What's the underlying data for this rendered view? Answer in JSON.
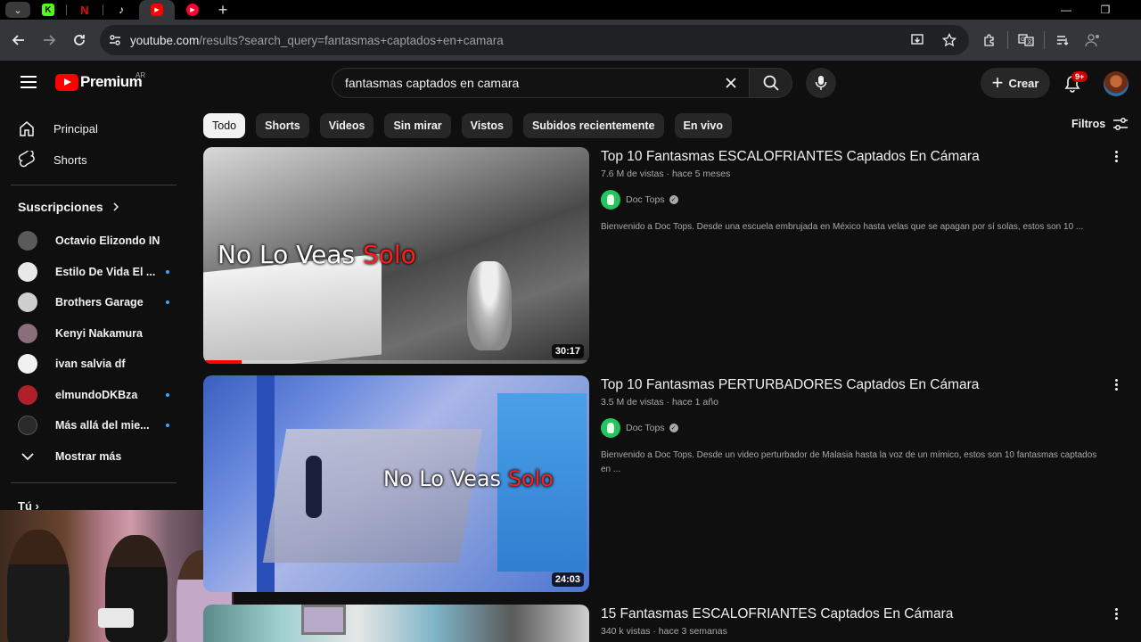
{
  "browser": {
    "url_host": "youtube.com",
    "url_rest": "/results?search_query=fantasmas+captados+en+camara"
  },
  "header": {
    "logo_text": "Premium",
    "country_code": "AR",
    "search_value": "fantasmas captados en camara",
    "create_label": "Crear",
    "notif_badge": "9+"
  },
  "sidebar": {
    "main": [
      {
        "label": "Principal",
        "icon": "home-icon"
      },
      {
        "label": "Shorts",
        "icon": "shorts-icon"
      }
    ],
    "subs_heading": "Suscripciones",
    "subs": [
      {
        "name": "Octavio Elizondo IN...",
        "color": "#5a5a5a",
        "dot": false
      },
      {
        "name": "Estilo De Vida El ...",
        "color": "#e8e8e8",
        "dot": true
      },
      {
        "name": "Brothers Garage",
        "color": "#cfcfcf",
        "dot": true
      },
      {
        "name": "Kenyi Nakamura",
        "color": "#8a6f7a",
        "dot": false
      },
      {
        "name": "ivan salvia df",
        "color": "#f1f1f1",
        "dot": false
      },
      {
        "name": "elmundoDKBza",
        "color": "#b0202a",
        "dot": true
      },
      {
        "name": "Más allá del mie...",
        "color": "#2a2a2a",
        "dot": true
      }
    ],
    "show_more": "Mostrar más",
    "you_heading": "Tú"
  },
  "chips": [
    "Todo",
    "Shorts",
    "Videos",
    "Sin mirar",
    "Vistos",
    "Subidos recientemente",
    "En vivo"
  ],
  "filters_label": "Filtros",
  "results": [
    {
      "title": "Top 10 Fantasmas ESCALOFRIANTES Captados En Cámara",
      "meta": "7.6 M de vistas · hace 5 meses",
      "channel": "Doc Tops",
      "description": "Bienvenido a Doc Tops. Desde una escuela embrujada en México hasta velas que se apagan por sí solas, estos son 10 ...",
      "duration": "30:17",
      "overlay_white": "No Lo Veas ",
      "overlay_red": "Solo",
      "watched_fraction": 0.1
    },
    {
      "title": "Top 10 Fantasmas PERTURBADORES Captados En Cámara",
      "meta": "3.5 M de vistas · hace 1 año",
      "channel": "Doc Tops",
      "description": "Bienvenido a Doc Tops. Desde un video perturbador de Malasia hasta la voz de un mímico, estos son 10 fantasmas captados en ...",
      "duration": "24:03",
      "overlay_white": "No Lo Veas ",
      "overlay_red": "Solo"
    },
    {
      "title": "15 Fantasmas ESCALOFRIANTES Captados En Cámara",
      "meta": "340 k vistas · hace 3 semanas"
    }
  ]
}
